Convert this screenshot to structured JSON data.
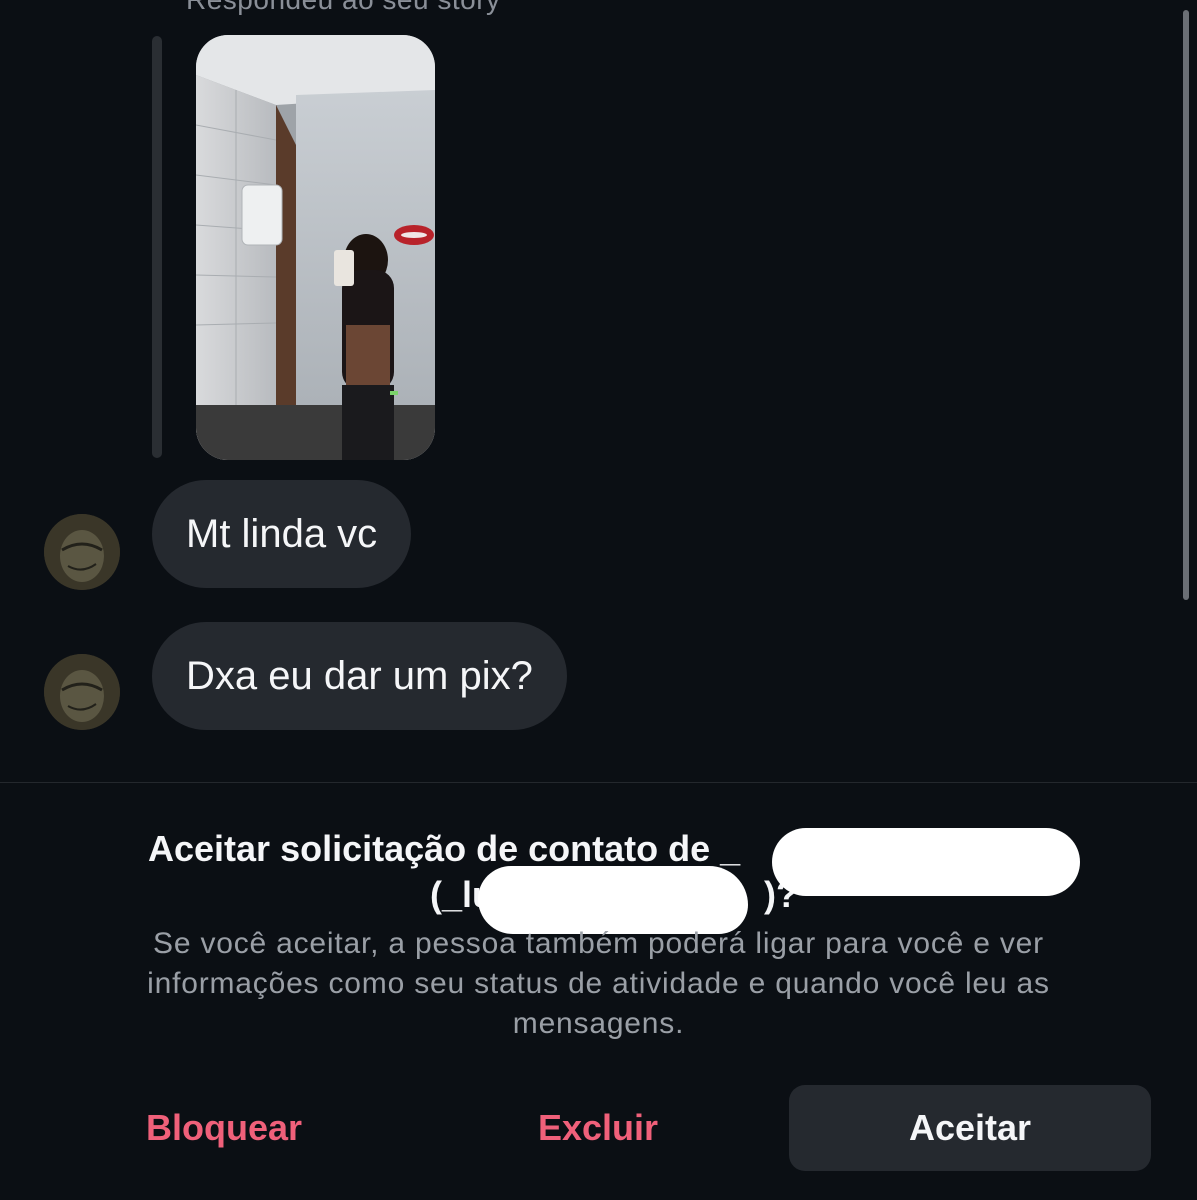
{
  "story": {
    "caption": "Respondeu ao seu story"
  },
  "messages": [
    {
      "text": "Mt linda vc"
    },
    {
      "text": "Dxa eu dar um pix?"
    }
  ],
  "request": {
    "title_prefix": "Aceitar solicitação de contato de _",
    "title_line2_prefix": "(_lu",
    "title_line2_suffix": ")?",
    "description": "Se você aceitar, a pessoa também poderá ligar para você e ver informações como seu status de atividade e quando você leu as mensagens."
  },
  "actions": {
    "block_label": "Bloquear",
    "delete_label": "Excluir",
    "accept_label": "Aceitar"
  },
  "colors": {
    "background": "#0b0f14",
    "bubble": "#25292f",
    "destructive": "#f0607a",
    "secondary_text": "#9a9fa6"
  }
}
